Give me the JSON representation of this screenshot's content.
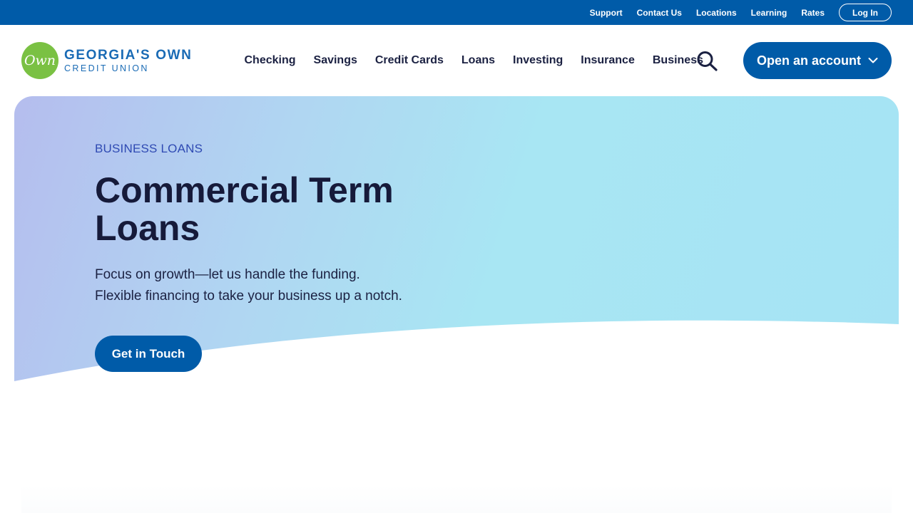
{
  "utility": {
    "links": [
      "Support",
      "Contact Us",
      "Locations",
      "Learning",
      "Rates"
    ],
    "login_label": "Log In"
  },
  "logo": {
    "mark": "Own",
    "line1": "GEORGIA'S OWN",
    "line2": "CREDIT UNION"
  },
  "nav": {
    "items": [
      "Checking",
      "Savings",
      "Credit Cards",
      "Loans",
      "Investing",
      "Insurance",
      "Business"
    ],
    "search_icon": "search-icon",
    "open_account_label": "Open an account",
    "open_account_icon": "chevron-down-icon"
  },
  "hero": {
    "eyebrow": "BUSINESS LOANS",
    "title": "Commercial Term Loans",
    "subtitle_line1": "Focus on growth—let us handle the funding.",
    "subtitle_line2": "Flexible financing to take your business up a notch.",
    "cta_label": "Get in Touch"
  },
  "colors": {
    "brand_blue": "#005ba8",
    "logo_green": "#7ac143",
    "heading": "#161a3a",
    "eyebrow": "#2f4ab3"
  }
}
